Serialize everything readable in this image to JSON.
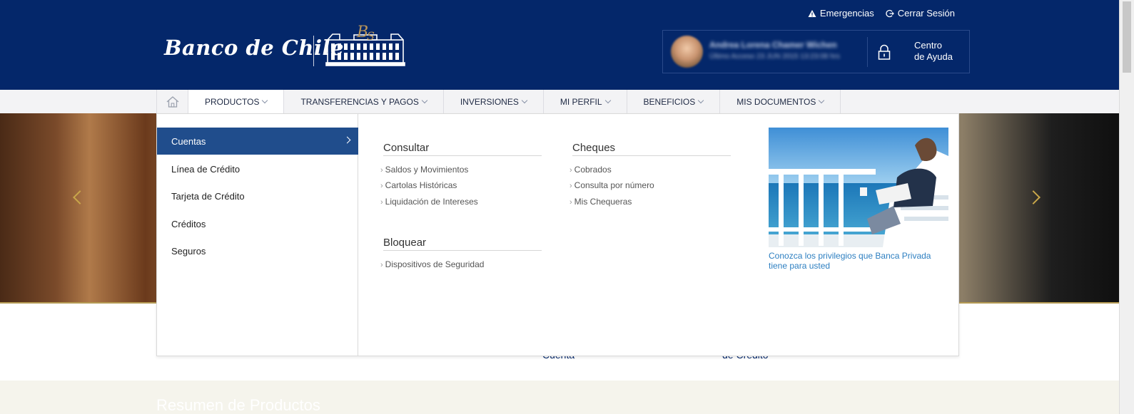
{
  "header": {
    "logo_text": "Banco de Chile",
    "top_links": [
      {
        "label": "Emergencias",
        "icon": "warning-icon"
      },
      {
        "label": "Cerrar Sesión",
        "icon": "logout-icon"
      }
    ],
    "user": {
      "name": "Andrea Lorena Chamer Wichen",
      "last_access": "Último Acceso 23 JUN 2015 13:23:08 hrs"
    },
    "help": {
      "label": "Centro\nde Ayuda",
      "icon": "lock-icon"
    }
  },
  "nav": {
    "items": [
      {
        "label": "PRODUCTOS"
      },
      {
        "label": "TRANSFERENCIAS Y PAGOS"
      },
      {
        "label": "INVERSIONES"
      },
      {
        "label": "MI PERFIL"
      },
      {
        "label": "BENEFICIOS"
      },
      {
        "label": "MIS DOCUMENTOS"
      }
    ]
  },
  "menu": {
    "left_items": [
      {
        "label": "Cuentas"
      },
      {
        "label": "Línea de Crédito"
      },
      {
        "label": "Tarjeta de Crédito"
      },
      {
        "label": "Créditos"
      },
      {
        "label": "Seguros"
      }
    ],
    "sections": {
      "consultar": {
        "title": "Consultar",
        "links": [
          "Saldos y Movimientos",
          "Cartolas Históricas",
          "Liquidación de Intereses"
        ]
      },
      "cheques": {
        "title": "Cheques",
        "links": [
          "Cobrados",
          "Consulta por número",
          "Mis Chequeras"
        ]
      },
      "bloquear": {
        "title": "Bloquear",
        "links": [
          "Dispositivos de Seguridad"
        ]
      }
    },
    "promo_caption": "Conozca los privilegios que Banca Privada tiene para usted"
  },
  "below": {
    "text1": "Cuenta",
    "text2": "de Crédito",
    "summary_title": "Resumen de Productos"
  },
  "colors": {
    "header_bg": "#04276a",
    "active_menu": "#204d8c",
    "link_blue": "#2d7fc1",
    "gold": "#c9a74a"
  }
}
